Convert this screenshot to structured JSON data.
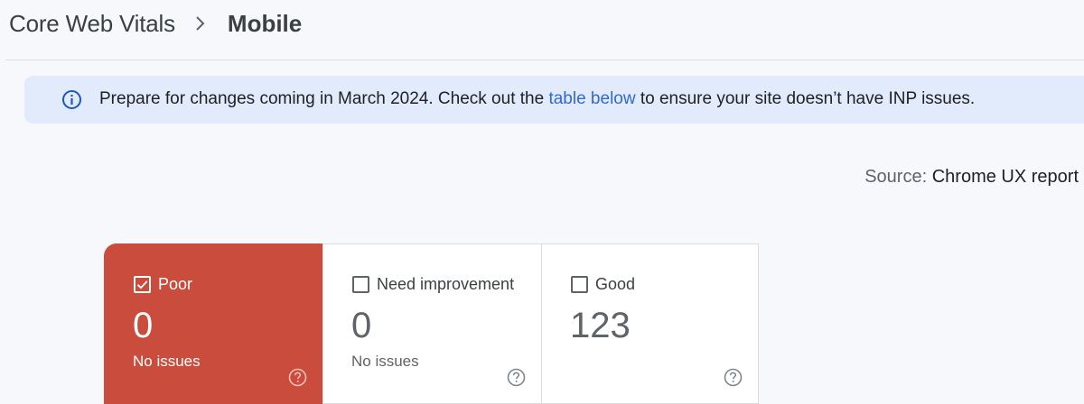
{
  "breadcrumb": {
    "parent": "Core Web Vitals",
    "current": "Mobile"
  },
  "banner": {
    "text_before": "Prepare for changes coming in March 2024. Check out the ",
    "link_text": "table below",
    "text_after": " to ensure your site doesn’t have INP issues."
  },
  "source": {
    "label": "Source:",
    "value": "Chrome UX report"
  },
  "cards": [
    {
      "label": "Poor",
      "value": "0",
      "subtitle": "No issues",
      "checked": true,
      "color": "#c94c3c"
    },
    {
      "label": "Need improvement",
      "value": "0",
      "subtitle": "No issues",
      "checked": false
    },
    {
      "label": "Good",
      "value": "123",
      "subtitle": "",
      "checked": false
    }
  ],
  "icons": {
    "banner": "info-icon",
    "separator": "chevron-right-icon",
    "help": "help-icon"
  }
}
